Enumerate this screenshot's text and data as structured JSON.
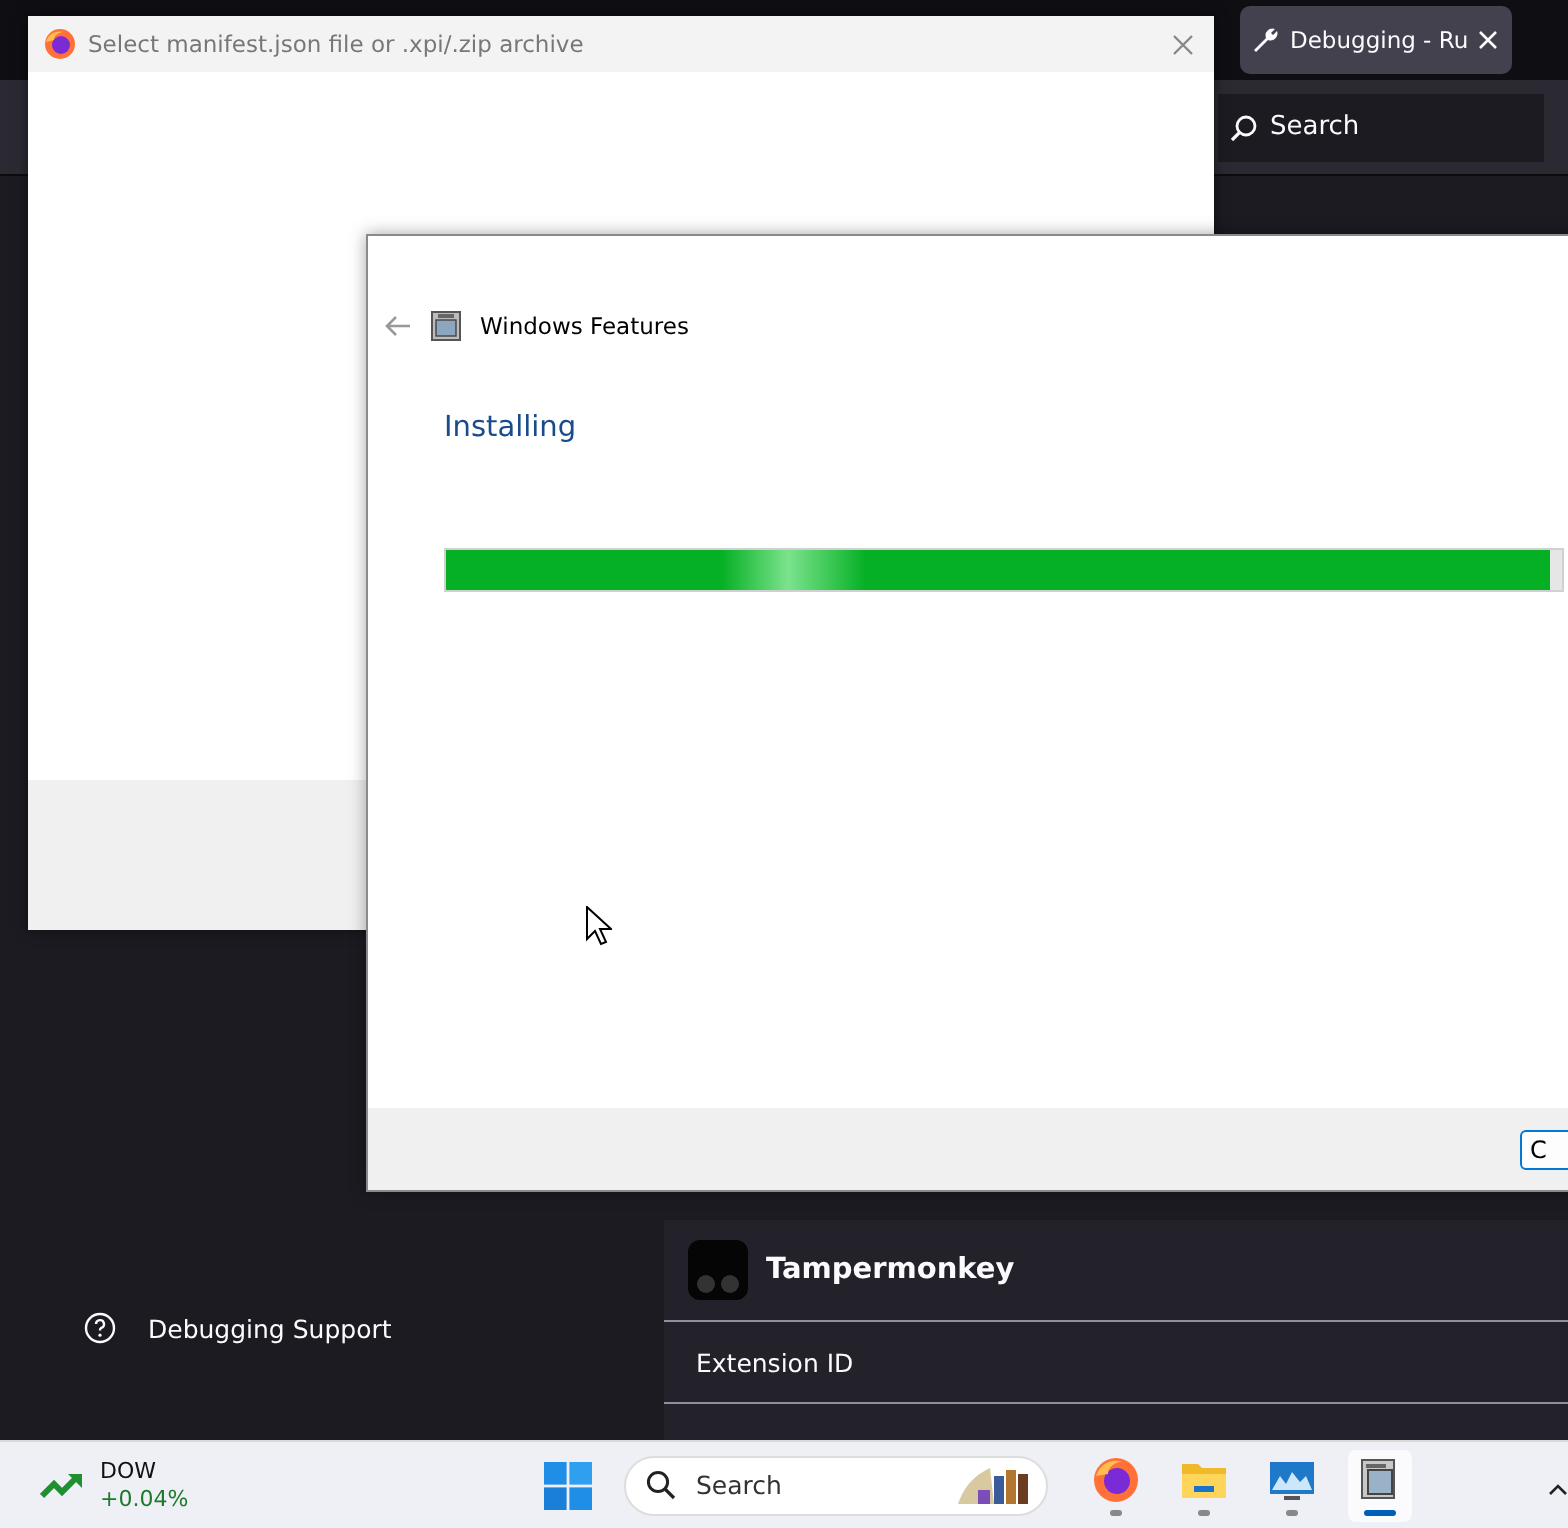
{
  "browser": {
    "tabs": [
      {
        "title": "Debugging - Ru",
        "selected": true
      }
    ],
    "search": {
      "placeholder": "Search"
    },
    "sidebar": {
      "items": [
        {
          "label": "Debugging Support"
        }
      ]
    },
    "extension": {
      "name": "Tampermonkey",
      "rows": [
        {
          "label": "Extension ID"
        }
      ]
    }
  },
  "file_dialog": {
    "title": "Select manifest.json file or .xpi/.zip archive"
  },
  "features_dialog": {
    "title": "Windows Features",
    "heading": "Installing",
    "progress": {
      "level": 0.99
    },
    "buttons": [
      "C"
    ]
  },
  "taskbar": {
    "widget": {
      "name": "DOW",
      "change": "+0.04%"
    },
    "search": {
      "placeholder": "Search"
    },
    "apps": [
      {
        "kind": "firefox",
        "active": false
      },
      {
        "kind": "folder",
        "active": false
      },
      {
        "kind": "monitor",
        "active": false
      },
      {
        "kind": "features",
        "active": true
      }
    ]
  }
}
